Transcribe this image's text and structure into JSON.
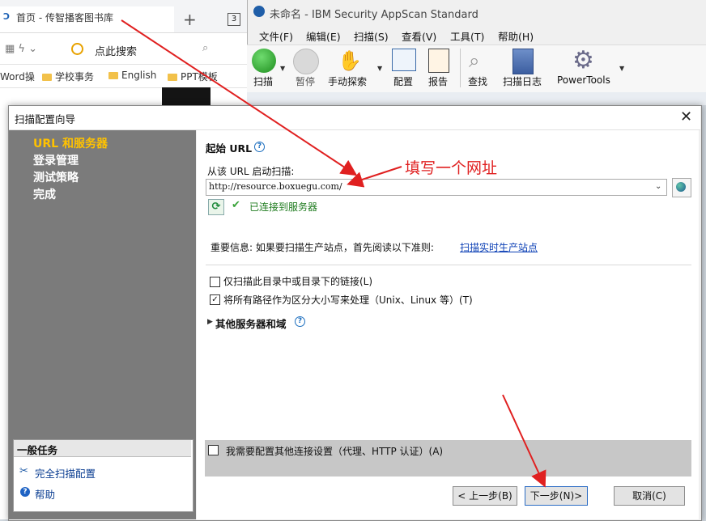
{
  "browser": {
    "tab_title": "首页 - 传智播客图书库",
    "new_tab": "+",
    "tab_count": "3",
    "search_text": "点此搜索",
    "bookmarks": [
      "Word操",
      "学校事务",
      "English",
      "PPT模板"
    ]
  },
  "app": {
    "title": "未命名 - IBM Security AppScan Standard",
    "menu": [
      "文件(F)",
      "编辑(E)",
      "扫描(S)",
      "查看(V)",
      "工具(T)",
      "帮助(H)"
    ],
    "toolbar": [
      "扫描",
      "暂停",
      "手动探索",
      "配置",
      "报告",
      "查找",
      "扫描日志",
      "PowerTools"
    ]
  },
  "dialog": {
    "title": "扫描配置向导",
    "nav": [
      "URL 和服务器",
      "登录管理",
      "测试策略",
      "完成"
    ],
    "tasks_title": "一般任务",
    "task_full_config": "完全扫描配置",
    "task_help": "帮助",
    "start_url_title": "起始 URL",
    "scan_from_label": "从该 URL 启动扫描:",
    "url_value": "http://resource.boxuegu.com/",
    "connected_status": "已连接到服务器",
    "important_text": "重要信息: 如果要扫描生产站点，首先阅读以下准则:",
    "prod_link": "扫描实时生产站点",
    "option_dir_only": "仅扫描此目录中或目录下的链接(L)",
    "option_dir_only_checked": false,
    "option_case_sensitive": "将所有路径作为区分大小写来处理（Unix、Linux 等）(T)",
    "option_case_sensitive_checked": true,
    "other_servers": "其他服务器和域",
    "proxy_label": "我需要配置其他连接设置（代理、HTTP 认证）(A)",
    "btn_back": "< 上一步(B)",
    "btn_next": "下一步(N)>",
    "btn_cancel": "取消(C)"
  },
  "annotation": "填写一个网址",
  "colors": {
    "nav_active": "#ffc200",
    "annotation_red": "#e02020",
    "link": "#0b3fb5"
  }
}
